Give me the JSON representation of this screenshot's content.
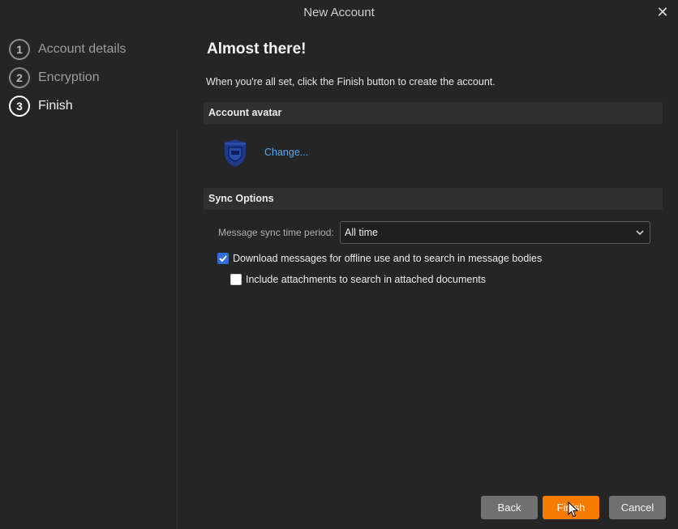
{
  "window": {
    "title": "New Account",
    "close_icon": "close-icon"
  },
  "steps": [
    {
      "number": "1",
      "label": "Account details",
      "active": false
    },
    {
      "number": "2",
      "label": "Encryption",
      "active": false
    },
    {
      "number": "3",
      "label": "Finish",
      "active": true
    }
  ],
  "main": {
    "heading": "Almost there!",
    "intro": "When you're all set, click the Finish button to create the account.",
    "avatar_section": {
      "title": "Account avatar",
      "avatar_icon": "shield-avatar-icon",
      "avatar_color": "#1f3a8a",
      "change_label": "Change..."
    },
    "sync_section": {
      "title": "Sync Options",
      "period_label": "Message sync time period:",
      "period_value": "All time",
      "download_label": "Download messages for offline use and to search in message bodies",
      "download_checked": true,
      "attachments_label": "Include attachments to search in attached documents",
      "attachments_checked": false
    }
  },
  "footer": {
    "back_label": "Back",
    "finish_label": "Finish",
    "cancel_label": "Cancel",
    "accent_color": "#f77b00"
  }
}
